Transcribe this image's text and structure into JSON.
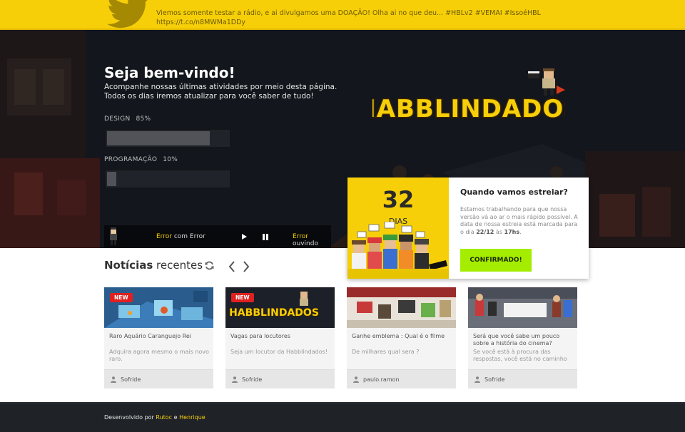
{
  "tweet": {
    "text": "Viemos somente testar a rádio, e ai divulgamos uma DOAÇÃO! Olha ai no que deu... #HBLv2 #VEMAI #IssoéHBL",
    "link": "https://t.co/n8MWMa1DDy"
  },
  "hero": {
    "title": "Seja bem-vindo!",
    "subtitle_line1": "Acompanhe nossas últimas atividades por meio desta página.",
    "subtitle_line2": "Todos os dias iremos atualizar para você saber de tudo!",
    "skills": [
      {
        "label": "DESIGN",
        "percent_text": "85%",
        "value": 0.85
      },
      {
        "label": "PROGRAMAÇÃO",
        "percent_text": "10%",
        "value": 0.1
      }
    ],
    "radio": {
      "dj_name": "Error",
      "dj_connector": "com",
      "dj_show": "Error",
      "listener": "Error",
      "listener_suffix": "ouvindo"
    },
    "logo_text": "HABBLINDADOS"
  },
  "countdown": {
    "number": "32",
    "unit": "DIAS",
    "title": "Quando vamos estreiar?",
    "desc_main": "Estamos trabalhando para que nossa versão vá ao ar o mais rápido possível. A data de nossa estreia está marcada para o dia ",
    "desc_date": "22/12",
    "desc_mid": " às ",
    "desc_time": "17hs",
    "desc_end": ".",
    "button": "CONFIRMADO!"
  },
  "news": {
    "title_bold": "Notícias",
    "title_rest": "recentes",
    "items": [
      {
        "badge": "NEW",
        "title": "Raro Aquário Caranguejo Rei",
        "desc": "Adquira agora mesmo o mais novo raro.",
        "author": "Sofride"
      },
      {
        "badge": "NEW",
        "title": "Vagas para locutores",
        "desc": "Seja um locutor da Habblindados!",
        "author": "Sofride",
        "image_text": "HABBLINDADOS"
      },
      {
        "badge": "",
        "title": "Ganhe emblema : Qual é o filme",
        "desc": "De milhares qual sera ?",
        "author": "paulo.ramon"
      },
      {
        "badge": "",
        "title": "Será que você sabe um pouco sobre a história do cinema?",
        "desc": "Se você está à procura das respostas, você está no caminho",
        "author": "Sofride"
      }
    ]
  },
  "footer": {
    "prefix": "Desenvolvido por",
    "author1": "Rutoc",
    "joiner": "e",
    "author2": "Henrique"
  },
  "colors": {
    "accent_yellow": "#f6cf09",
    "confirm_green": "#a4ed00",
    "badge_red": "#e02020",
    "footer_bg": "#1f2227"
  }
}
